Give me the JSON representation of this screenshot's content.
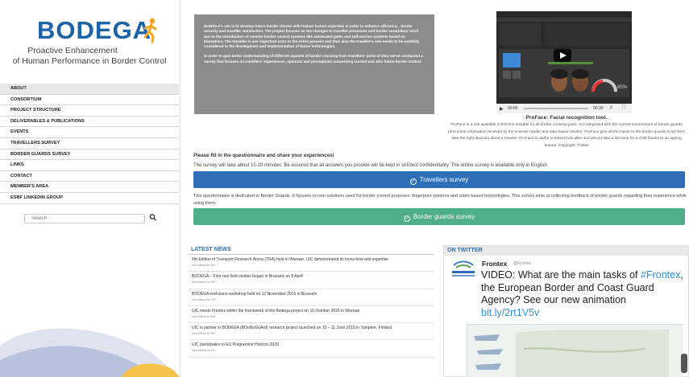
{
  "sidebar": {
    "logo_word": "BODEGA",
    "tagline_1": "Proactive Enhancement",
    "tagline_2": "of Human Performance in Border Control",
    "nav": [
      {
        "label": "ABOUT",
        "active": true
      },
      {
        "label": "CONSORTIUM"
      },
      {
        "label": "PROJECT STRUCTURE"
      },
      {
        "label": "DELIVERABLES & PUBLICATIONS"
      },
      {
        "label": "EVENTS"
      },
      {
        "label": "TRAVELLERS SURVEY"
      },
      {
        "label": "BORDER GUARDS SURVEY"
      },
      {
        "label": "LINKS"
      },
      {
        "label": "CONTACT"
      },
      {
        "label": "MEMBER'S AREA"
      },
      {
        "label": "ESBF LINKEDIN GROUP"
      }
    ],
    "search_placeholder": "Search",
    "search_icon": "magnifier-icon"
  },
  "intro": {
    "para1": "BODEGA's aim is to develop future border checks with human factors expertise in order to enhance efficiency , border security and traveller satisfaction. The project focuses on the changes to traveller processes and border controllers' work due to the introduction of smarter border control systems like automated gates and self-service systems based on biometrics. The traveller is one important actor in the entire process and thus also the traveller's role needs to be carefully considered in the development and implementation of future technologies.",
    "para2": "In order to gain better understanding of different aspects of border crossing from travellers' point of view we've conducted a survey that focuses on travellers' experiences, opinions and perceptions concerning current and also future border control."
  },
  "video": {
    "time_start": "00:00",
    "time_end": "00:30",
    "gauge_value": "85%"
  },
  "video_caption": {
    "title": "ProFace: Facial recognition tool.",
    "text": "ProFace is a tool available in first line suitable for all border crossing point. It is integrated with the current environment of border guards (document information received by the scanner reader and data based results). ProFace give all the inputs to the border guards to let them take the right decision about a traveler. ProFace is useful to detect look alike and also to take a decision for a child thanks to an ageing feature. Copyright: Thales"
  },
  "survey": {
    "heading": "Please fill in the questionnaire and share your experiences!",
    "intro": "The survey will take about 15-20 minutes. Be assured that all answers you provide will be kept in strictest confidentiality. The online survey is available only in English.",
    "travellers_btn": "Travellers survey",
    "bg_text": "This questionnaire is dedicated to Border Guards. It focuses on two solutions used for border control purposes: fingerprint systems and video-based technologies. This survey aims at collecting feedback of border guards regarding their experience while using them.",
    "bg_btn": "Border guards survey"
  },
  "news": {
    "heading": "LATEST NEWS",
    "items": [
      {
        "title": "6th Edition of Transport Research Arena (TRA) held in Warsaw: UIC demonstrated its know-how and expertise",
        "meta": "from eNews Nr 493"
      },
      {
        "title": "BODEGA – First real field studies began in Brussels on 8 April!",
        "meta": "from eNews Nr 492"
      },
      {
        "title": "BODEGA end-users workshop held on 12 November 2015 in Brussels",
        "meta": "from eNews Nr 473"
      },
      {
        "title": "UIC meets Frontex within the framework of the Bodega project on 15 October 2015 in Warsaw",
        "meta": "from eNews Nr 466"
      },
      {
        "title": "UIC is partner in BODEGA (BOrdErGuArd) research project launched on 10 – 11 June 2015 in Tampere, Finland",
        "meta": "from eNews Nr 453"
      },
      {
        "title": "UIC participates in EU Programme Horizon 2020",
        "meta": "from eNews Nr 430"
      }
    ]
  },
  "twitter": {
    "heading": "ON TWITTER",
    "name": "Frontex",
    "handle": "@Frontex",
    "text_pre": "VIDEO: What are the main tasks of ",
    "hashtag": "#Frontex",
    "text_mid": ", the European Border and Coast Guard Agency? See our new animation ",
    "link": "bit.ly/2rt1V5v"
  }
}
